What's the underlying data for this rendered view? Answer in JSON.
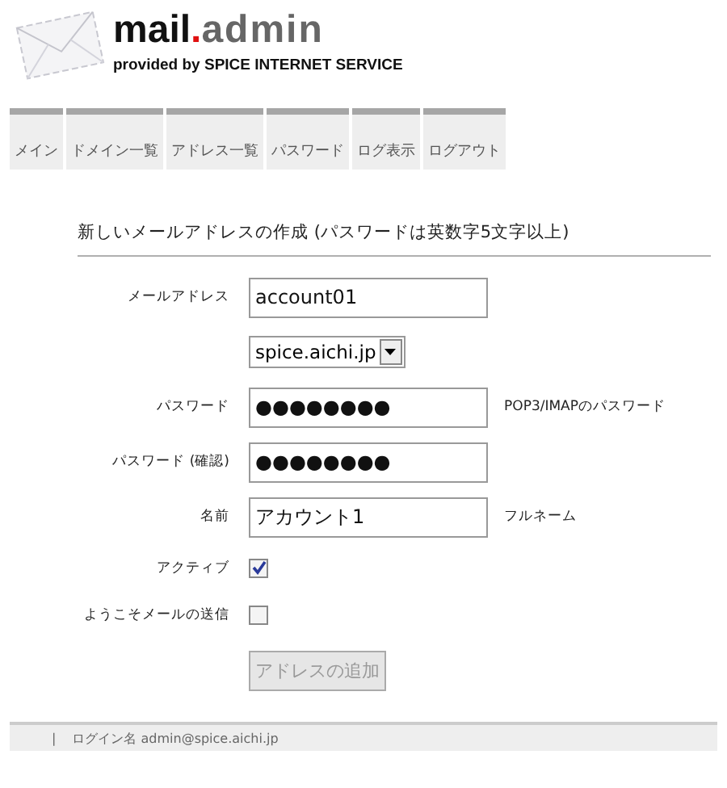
{
  "logo": {
    "primary": "mail",
    "dot": ".",
    "secondary": "admin",
    "tagline": "provided by SPICE INTERNET SERVICE"
  },
  "tabs": [
    {
      "label": "メイン",
      "selected": false
    },
    {
      "label": "ドメイン一覧",
      "selected": false
    },
    {
      "label": "アドレス一覧",
      "selected": false
    },
    {
      "label": "パスワード",
      "selected": false
    },
    {
      "label": "ログ表示",
      "selected": false
    },
    {
      "label": "ログアウト",
      "selected": false
    }
  ],
  "form": {
    "title": "新しいメールアドレスの作成 (パスワードは英数字5文字以上)",
    "rows": [
      {
        "kind": "text",
        "label": "メールアドレス",
        "value": "account01"
      },
      {
        "kind": "select",
        "value": "spice.aichi.jp"
      },
      {
        "kind": "text",
        "label": "パスワード",
        "value": "●●●●●●●●",
        "hint": "POP3/IMAPのパスワード"
      },
      {
        "kind": "text",
        "label": "パスワード (確認)",
        "value": "●●●●●●●●"
      },
      {
        "kind": "text",
        "label": "名前",
        "value": "アカウント1",
        "hint": "フルネーム"
      },
      {
        "kind": "checkbox",
        "label": "アクティブ",
        "checked": true
      },
      {
        "kind": "checkbox",
        "label": "ようこそメールの送信",
        "checked": false
      }
    ],
    "submit": {
      "label": "アドレスの追加",
      "disabled": true
    }
  },
  "footer": {
    "separator": "|",
    "login": "ログイン名 admin@spice.aichi.jp"
  }
}
